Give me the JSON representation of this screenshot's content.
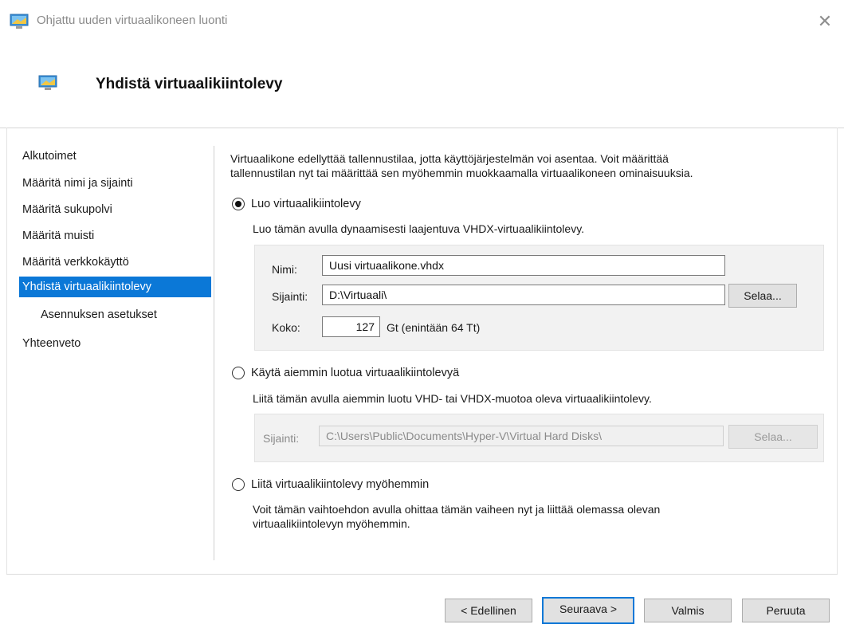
{
  "window": {
    "title": "Ohjattu uuden virtuaalikoneen luonti",
    "close_glyph": "✕"
  },
  "header": {
    "title": "Yhdistä virtuaalikiintolevy"
  },
  "nav": {
    "items": [
      {
        "label": "Alkutoimet"
      },
      {
        "label": "Määritä nimi ja sijainti"
      },
      {
        "label": "Määritä sukupolvi"
      },
      {
        "label": "Määritä muisti"
      },
      {
        "label": "Määritä verkkokäyttö"
      },
      {
        "label": "Yhdistä virtuaalikiintolevy",
        "active": true
      },
      {
        "label": "Asennuksen asetukset",
        "sub": true
      },
      {
        "label": "Yhteenveto"
      }
    ]
  },
  "main": {
    "intro_line1": "Virtuaalikone edellyttää tallennustilaa, jotta käyttöjärjestelmän voi asentaa. Voit määrittää",
    "intro_line2": "tallennustilan nyt tai määrittää sen myöhemmin muokkaamalla virtuaalikoneen ominaisuuksia.",
    "option_create": {
      "label": "Luo virtuaalikiintolevy",
      "checked": true,
      "description": "Luo tämän avulla dynaamisesti laajentuva VHDX-virtuaalikiintolevy.",
      "name_label": "Nimi:",
      "name_value": "Uusi virtuaalikone.vhdx",
      "location_label": "Sijainti:",
      "location_value": "D:\\Virtuaali\\",
      "browse_label": "Selaa...",
      "size_label": "Koko:",
      "size_value": "127",
      "size_unit": "Gt (enintään 64 Tt)"
    },
    "option_existing": {
      "label": "Käytä aiemmin luotua virtuaalikiintolevyä",
      "checked": false,
      "description": "Liitä tämän avulla aiemmin luotu VHD- tai VHDX-muotoa oleva virtuaalikiintolevy.",
      "location_label": "Sijainti:",
      "location_value": "C:\\Users\\Public\\Documents\\Hyper-V\\Virtual Hard Disks\\",
      "browse_label": "Selaa..."
    },
    "option_later": {
      "label": "Liitä virtuaalikiintolevy myöhemmin",
      "checked": false,
      "description_line1": "Voit tämän vaihtoehdon avulla ohittaa tämän vaiheen nyt ja liittää olemassa olevan",
      "description_line2": "virtuaalikiintolevyn myöhemmin."
    }
  },
  "footer": {
    "previous": "< Edellinen",
    "next": "Seuraava >",
    "finish": "Valmis",
    "cancel": "Peruuta"
  },
  "colors": {
    "accent": "#0b78d7"
  },
  "icons": {
    "app": "monitor-icon",
    "header": "monitor-icon",
    "close": "close-icon"
  }
}
